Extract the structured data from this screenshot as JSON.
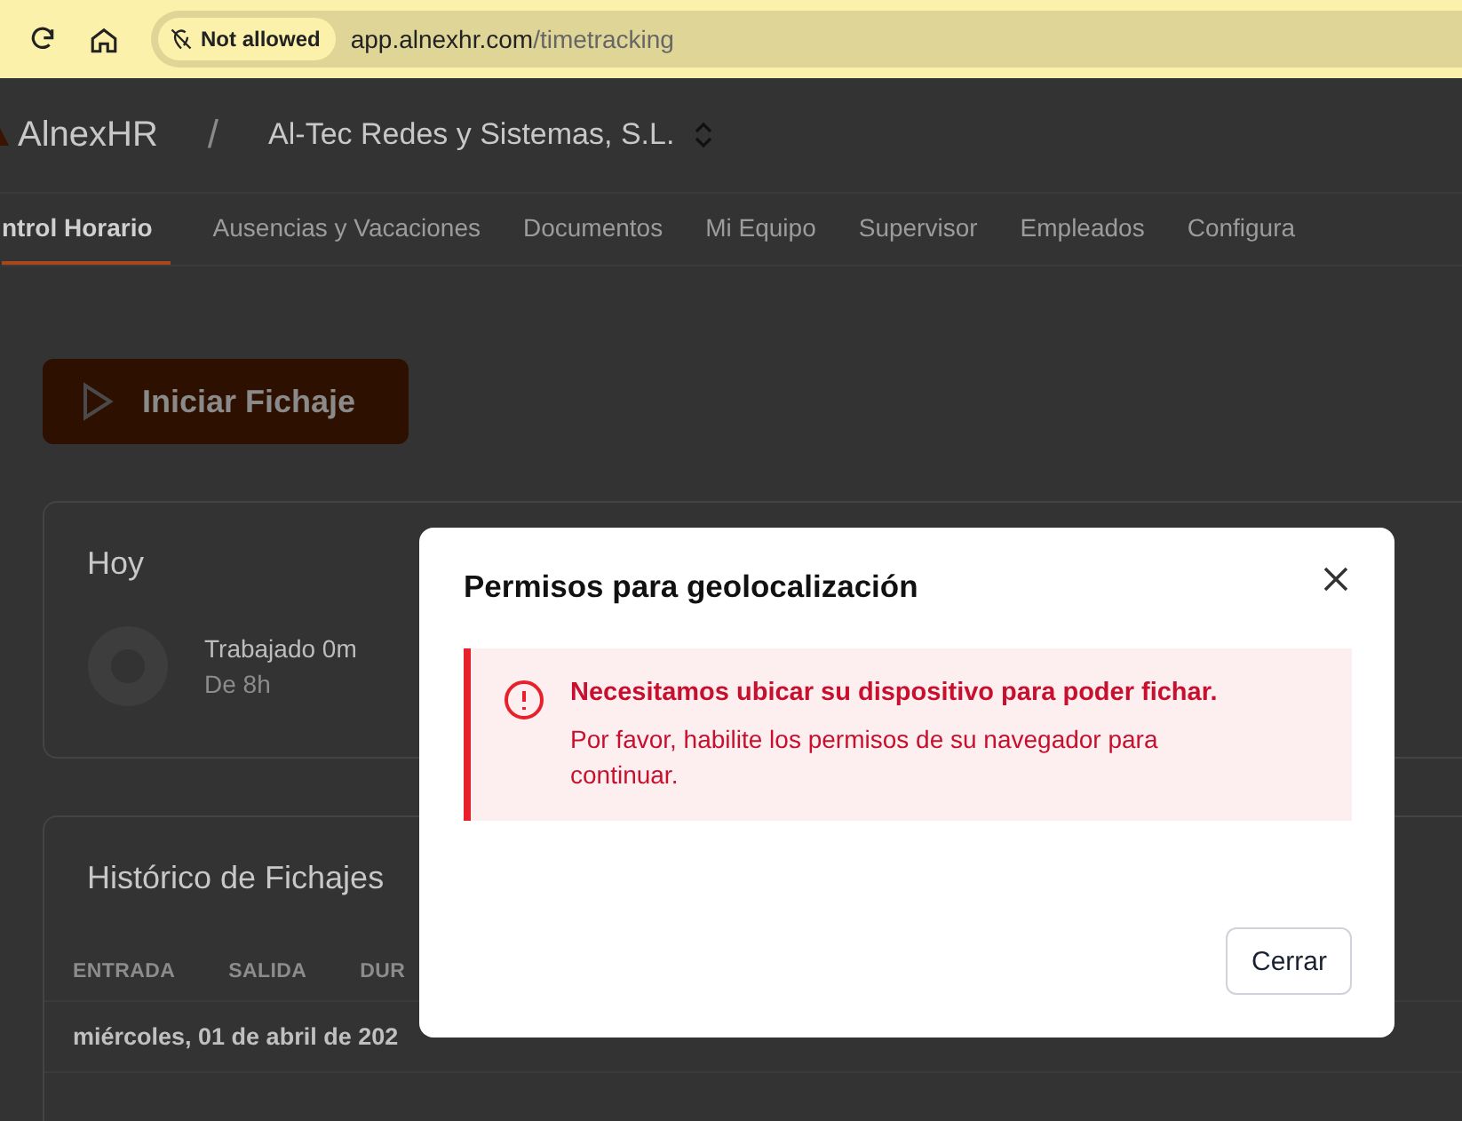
{
  "browser": {
    "permission_chip": "Not allowed",
    "url_host": "app.alnexhr.com",
    "url_path": "/timetracking"
  },
  "header": {
    "brand": "AlnexHR",
    "separator": "/",
    "company": "Al-Tec Redes y Sistemas, S.L."
  },
  "tabs": [
    {
      "label": "ntrol Horario",
      "selected": true
    },
    {
      "label": "Ausencias y Vacaciones",
      "selected": false
    },
    {
      "label": "Documentos",
      "selected": false
    },
    {
      "label": "Mi Equipo",
      "selected": false
    },
    {
      "label": "Supervisor",
      "selected": false
    },
    {
      "label": "Empleados",
      "selected": false
    },
    {
      "label": "Configura",
      "selected": false
    }
  ],
  "start_button": "Iniciar Fichaje",
  "today": {
    "title": "Hoy",
    "worked": "Trabajado 0m",
    "target": "De 8h"
  },
  "history": {
    "title": "Histórico de Fichajes",
    "columns": [
      "ENTRADA",
      "SALIDA",
      "DUR"
    ],
    "rows": [
      {
        "date": "miércoles, 01 de abril de 202"
      }
    ]
  },
  "dialog": {
    "title": "Permisos para geolocalización",
    "alert_title": "Necesitamos ubicar su dispositivo para poder fichar.",
    "alert_body": "Por favor, habilite los permisos de su navegador para continuar.",
    "button": "Cerrar"
  }
}
